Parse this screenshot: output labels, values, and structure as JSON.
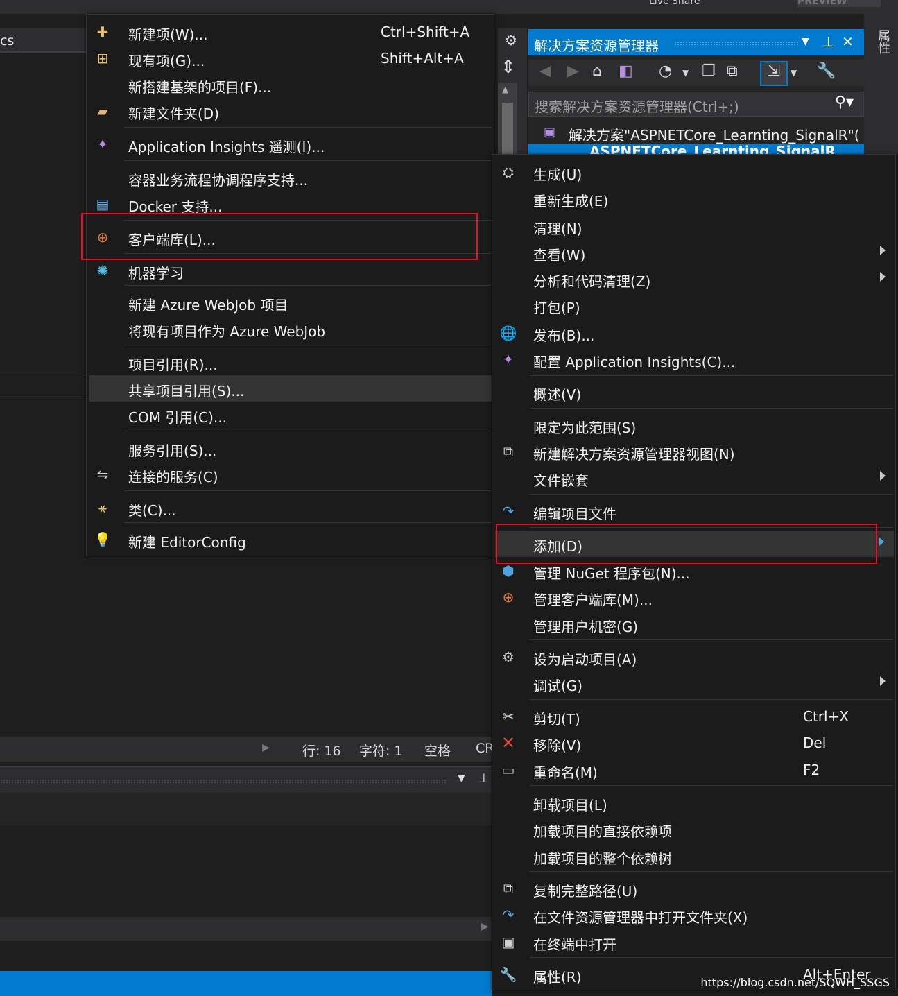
{
  "ide": {
    "file_tab": "cs",
    "status": {
      "line": "行: 16",
      "char": "字符: 1",
      "space": "空格",
      "crlf": "CR"
    },
    "properties_tab": "属性",
    "top_ghost": "Live Share",
    "top_ghost2": "PREVIEW"
  },
  "solution_explorer": {
    "title": "解决方案资源管理器",
    "search_placeholder": "搜索解决方案资源管理器(Ctrl+;)",
    "solution_item": "解决方案\"ASPNETCore_Learnting_SignalR\"(",
    "project_item": "ASPNETCore_Learnting_SignalR"
  },
  "add_submenu": {
    "items": [
      {
        "label": "新建项(W)...",
        "shortcut": "Ctrl+Shift+A"
      },
      {
        "label": "现有项(G)...",
        "shortcut": "Shift+Alt+A"
      },
      {
        "label": "新搭建基架的项目(F)..."
      },
      {
        "label": "新建文件夹(D)"
      },
      {
        "label": "Application Insights 遥测(I)..."
      },
      {
        "label": "容器业务流程协调程序支持..."
      },
      {
        "label": "Docker 支持..."
      },
      {
        "label": "客户端库(L)..."
      },
      {
        "label": "机器学习"
      },
      {
        "label": "新建 Azure WebJob 项目"
      },
      {
        "label": "将现有项目作为 Azure WebJob"
      },
      {
        "label": "项目引用(R)..."
      },
      {
        "label": "共享项目引用(S)..."
      },
      {
        "label": "COM 引用(C)..."
      },
      {
        "label": "服务引用(S)..."
      },
      {
        "label": "连接的服务(C)"
      },
      {
        "label": "类(C)..."
      },
      {
        "label": "新建 EditorConfig"
      }
    ]
  },
  "context_menu": {
    "items": [
      {
        "label": "生成(U)"
      },
      {
        "label": "重新生成(E)"
      },
      {
        "label": "清理(N)"
      },
      {
        "label": "查看(W)"
      },
      {
        "label": "分析和代码清理(Z)"
      },
      {
        "label": "打包(P)"
      },
      {
        "label": "发布(B)..."
      },
      {
        "label": "配置 Application Insights(C)..."
      },
      {
        "label": "概述(V)"
      },
      {
        "label": "限定为此范围(S)"
      },
      {
        "label": "新建解决方案资源管理器视图(N)"
      },
      {
        "label": "文件嵌套"
      },
      {
        "label": "编辑项目文件"
      },
      {
        "label": "添加(D)"
      },
      {
        "label": "管理 NuGet 程序包(N)..."
      },
      {
        "label": "管理客户端库(M)..."
      },
      {
        "label": "管理用户机密(G)"
      },
      {
        "label": "设为启动项目(A)"
      },
      {
        "label": "调试(G)"
      },
      {
        "label": "剪切(T)",
        "shortcut": "Ctrl+X"
      },
      {
        "label": "移除(V)",
        "shortcut": "Del"
      },
      {
        "label": "重命名(M)",
        "shortcut": "F2"
      },
      {
        "label": "卸载项目(L)"
      },
      {
        "label": "加载项目的直接依赖项"
      },
      {
        "label": "加载项目的整个依赖树"
      },
      {
        "label": "复制完整路径(U)"
      },
      {
        "label": "在文件资源管理器中打开文件夹(X)"
      },
      {
        "label": "在终端中打开"
      },
      {
        "label": "属性(R)",
        "shortcut": "Alt+Enter"
      }
    ]
  },
  "watermark": "https://blog.csdn.net/SQWH_SSGS",
  "colors": {
    "accent": "#007acc",
    "highlight_box": "#e81123",
    "menu_bg": "#1b1b1c"
  }
}
